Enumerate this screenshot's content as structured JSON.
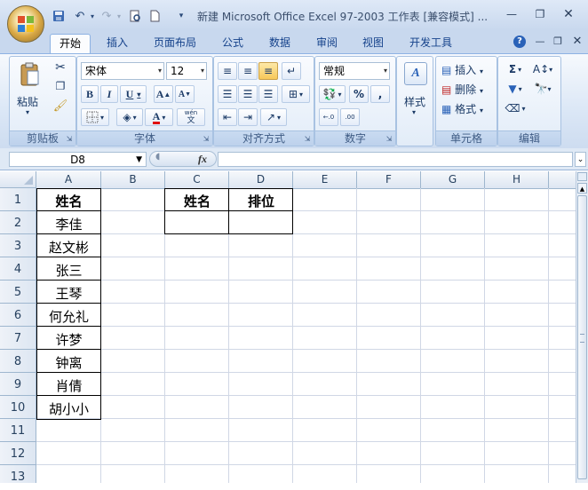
{
  "window": {
    "title": "新建 Microsoft Office Excel 97-2003 工作表 [兼容模式] ..."
  },
  "ribbon_tabs": [
    "开始",
    "插入",
    "页面布局",
    "公式",
    "数据",
    "审阅",
    "视图",
    "开发工具"
  ],
  "active_tab": "开始",
  "ribbon": {
    "clipboard": {
      "label": "剪贴板",
      "paste_label": "粘贴"
    },
    "font": {
      "label": "字体",
      "font_name": "宋体",
      "font_size": "12",
      "phonetic_glyph": "wén",
      "phonetic_char": "文"
    },
    "alignment": {
      "label": "对齐方式"
    },
    "number": {
      "label": "数字",
      "format": "常规",
      "percent": "%",
      "comma": ",",
      "inc_decimal": ".0←.00",
      "dec_decimal": ".00→.0"
    },
    "styles": {
      "label": "样式"
    },
    "cells": {
      "label": "单元格",
      "insert": "插入",
      "delete": "删除",
      "format": "格式"
    },
    "editing": {
      "label": "编辑"
    }
  },
  "formula_bar": {
    "name_box": "D8",
    "fx": "fx",
    "value": ""
  },
  "columns": [
    "A",
    "B",
    "C",
    "D",
    "E",
    "F",
    "G",
    "H"
  ],
  "rows": [
    "1",
    "2",
    "3",
    "4",
    "5",
    "6",
    "7",
    "8",
    "9",
    "10",
    "11",
    "12",
    "13"
  ],
  "cells": {
    "A1": "姓名",
    "A2": "李佳",
    "A3": "赵文彬",
    "A4": "张三",
    "A5": "王琴",
    "A6": "何允礼",
    "A7": "许梦",
    "A8": "钟离",
    "A9": "肖倩",
    "A10": "胡小小",
    "C1": "姓名",
    "D1": "排位"
  },
  "colors": {
    "title_bar": "#c8d8ee",
    "ribbon_text": "#15428b",
    "grid_line": "#d0d7e5",
    "header_border": "#9eb6ce"
  }
}
